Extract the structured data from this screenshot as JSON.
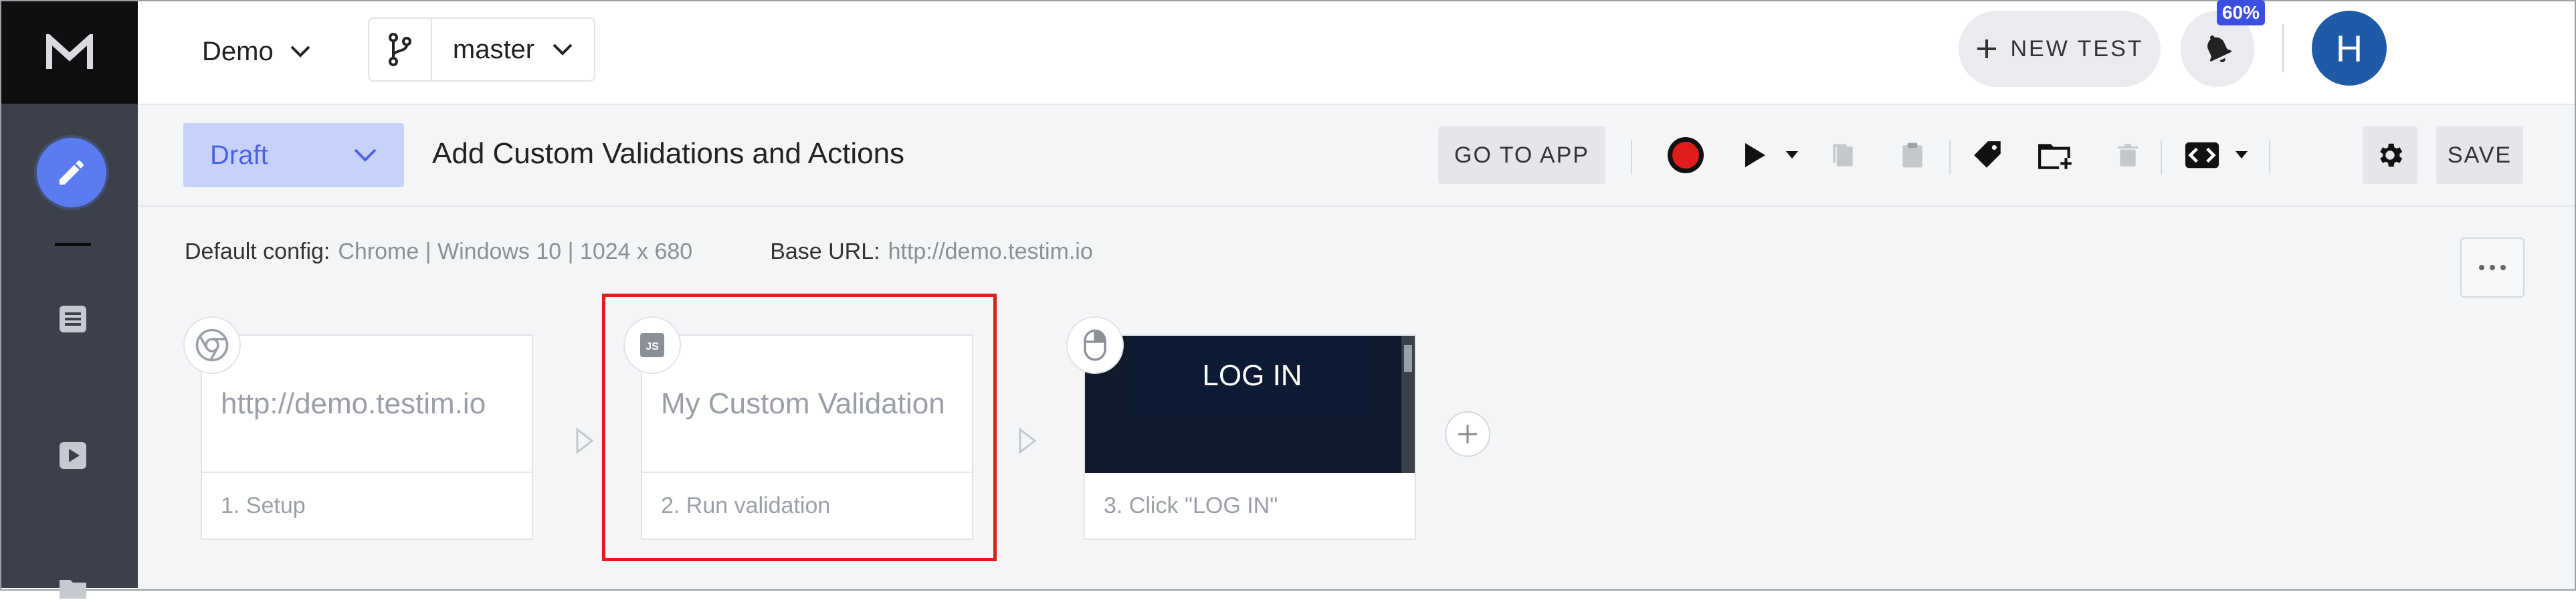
{
  "project": {
    "name": "Demo"
  },
  "branch": {
    "name": "master"
  },
  "header": {
    "new_test_label": "NEW TEST",
    "notification_badge": "60%",
    "avatar_initial": "H"
  },
  "test": {
    "status": "Draft",
    "title": "Add Custom Validations and Actions",
    "goto_app_label": "GO TO APP",
    "save_label": "SAVE"
  },
  "config": {
    "default_config_label": "Default config:",
    "default_config_value": "Chrome | Windows 10 | 1024 x 680",
    "base_url_label": "Base URL:",
    "base_url_value": "http://demo.testim.io"
  },
  "steps": [
    {
      "body": "http://demo.testim.io",
      "label": "1. Setup",
      "icon": "chrome-icon"
    },
    {
      "body": "My Custom Validation",
      "label": "2. Run validation",
      "icon": "js-icon"
    },
    {
      "body": "LOG IN",
      "label": "3. Click \"LOG IN\"",
      "icon": "mouse-icon"
    }
  ],
  "colors": {
    "accent": "#5b7cf0",
    "record": "#e01d1d",
    "sidebar": "#3b404a",
    "highlight": "#e01d1d"
  }
}
